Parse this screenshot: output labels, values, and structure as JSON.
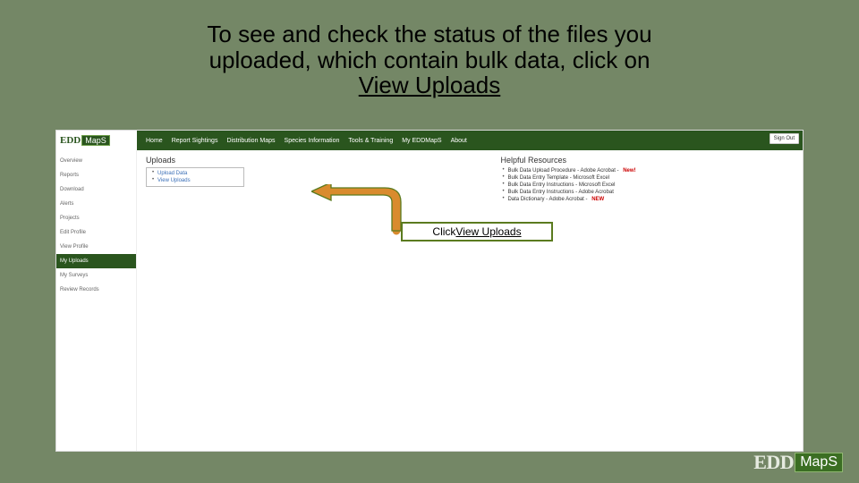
{
  "slide": {
    "title_line1": "To see and check the status of the files you",
    "title_line2": "uploaded, which contain bulk data, click on",
    "title_line3": "View Uploads",
    "callout_prefix": "Click ",
    "callout_link": "View Uploads"
  },
  "brand": {
    "edd": "EDD",
    "maps": "MapS",
    "sub": ""
  },
  "header": {
    "nav": {
      "home": "Home",
      "report": "Report Sightings",
      "dist": "Distribution Maps",
      "species": "Species Information",
      "tools": "Tools & Training",
      "myedd": "My EDDMapS",
      "about": "About"
    },
    "signout": "Sign Out"
  },
  "sidebar": {
    "overview": "Overview",
    "reports": "Reports",
    "download": "Download",
    "alerts": "Alerts",
    "projects": "Projects",
    "editprofile": "Edit Profile",
    "viewprofile": "View Profile",
    "myuploads": "My Uploads",
    "mysurveys": "My Surveys",
    "reviewrecords": "Review Records"
  },
  "uploads": {
    "heading": "Uploads",
    "upload_data": "Upload Data",
    "view_uploads": "View Uploads"
  },
  "resources": {
    "heading": "Helpful Resources",
    "r1_text": "Bulk Data Upload Procedure - Adobe Acrobat -",
    "r1_new": "New!",
    "r2_text": "Bulk Data Entry Template - Microsoft Excel",
    "r3_text": "Bulk Data Entry Instructions - Microsoft Excel",
    "r4_text": "Bulk Data Entry Instructions - Adobe Acrobat",
    "r5_text": "Data Dictionary - Adobe Acrobat -",
    "r5_new": "NEW"
  },
  "footer": {
    "edd": "EDD",
    "maps": "MapS"
  }
}
